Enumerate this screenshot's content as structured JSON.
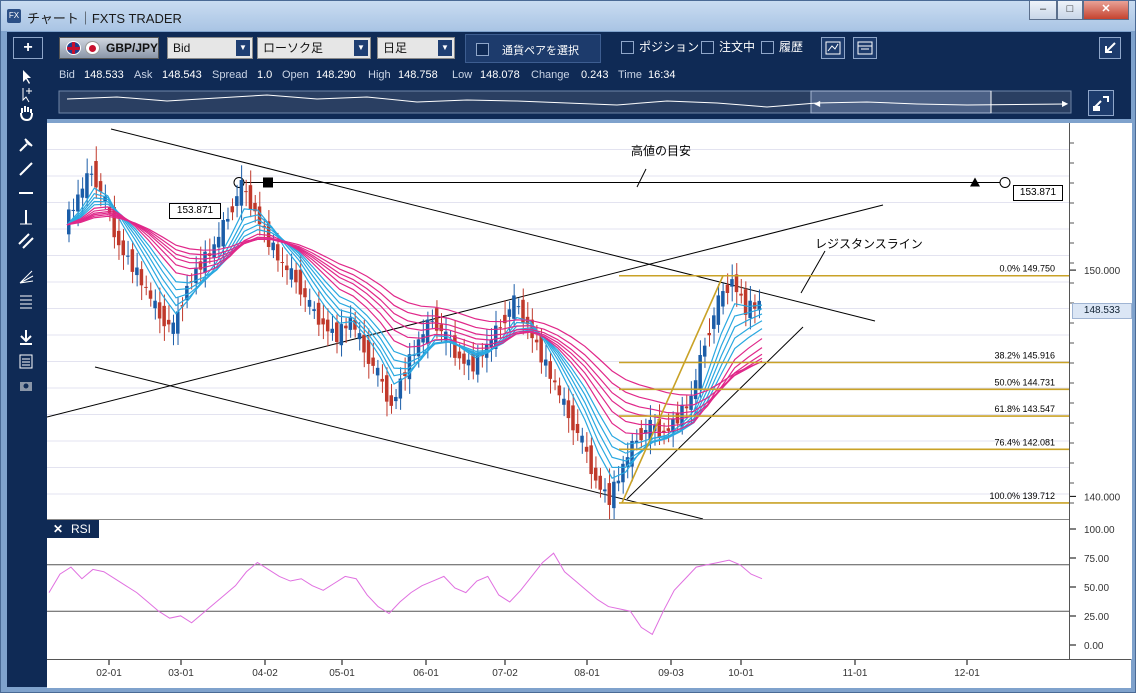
{
  "window": {
    "title": "チャート｜FXTS TRADER",
    "icon_label": "FX",
    "buttons": {
      "minimize": "–",
      "maximize": "□",
      "close": "✕"
    }
  },
  "toolbar": {
    "add_button": "+",
    "symbol": "GBP/JPY",
    "price_type": "Bid",
    "chart_type": "ローソク足",
    "timeframe": "日足",
    "currency_pair_select": "通貨ペアを選択",
    "position": "ポジション",
    "orders": "注文中",
    "history": "履歴"
  },
  "quote": {
    "bid_label": "Bid",
    "bid": "148.533",
    "ask_label": "Ask",
    "ask": "148.543",
    "spread_label": "Spread",
    "spread": "1.0",
    "open_label": "Open",
    "open": "148.290",
    "high_label": "High",
    "high": "148.758",
    "low_label": "Low",
    "low": "148.078",
    "change_label": "Change",
    "change": "0.243",
    "time_label": "Time",
    "time": "16:34"
  },
  "annotations": {
    "high_target": "高値の目安",
    "resistance": "レジスタンスライン",
    "level_left": "153.871",
    "level_right": "153.871",
    "current_price": "148.533"
  },
  "rsi_panel": {
    "label": "RSI"
  },
  "colors": {
    "panel_bg": "#0f2a55",
    "candle_up": "#1b5da8",
    "candle_down": "#c0392b",
    "fib": "#c9a227",
    "ema_fast": "#29a8e0",
    "ema_slow": "#e0288a",
    "rsi": "#e070e0"
  },
  "chart_data": [
    {
      "type": "candlestick",
      "title": "",
      "x_ticks": [
        "02-01",
        "03-01",
        "04-02",
        "05-01",
        "06-01",
        "07-02",
        "08-01",
        "09-03",
        "10-01",
        "11-01",
        "12-01"
      ],
      "y_ticks": [
        140.0,
        150.0
      ],
      "ylim": [
        139.0,
        156.5
      ],
      "closes": [
        152.0,
        153.2,
        154.4,
        153.0,
        151.1,
        150.2,
        149.1,
        148.0,
        147.4,
        149.3,
        150.3,
        151.0,
        152.4,
        153.7,
        152.6,
        151.3,
        150.2,
        149.6,
        148.4,
        147.6,
        147.1,
        147.8,
        146.5,
        145.4,
        144.0,
        145.6,
        146.8,
        147.9,
        147.0,
        146.1,
        145.8,
        146.6,
        147.6,
        148.6,
        147.6,
        146.2,
        144.9,
        143.6,
        142.4,
        140.7,
        139.9,
        141.3,
        142.6,
        143.1,
        142.8,
        143.5,
        144.3,
        146.8,
        148.6,
        149.6,
        148.3,
        148.5
      ],
      "fibonacci": [
        {
          "label": "0.0%",
          "value": 149.75
        },
        {
          "label": "38.2%",
          "value": 145.916
        },
        {
          "label": "50.0%",
          "value": 144.731
        },
        {
          "label": "61.8%",
          "value": 143.547
        },
        {
          "label": "76.4%",
          "value": 142.081
        },
        {
          "label": "100.0%",
          "value": 139.712
        }
      ],
      "horizontal_line": 153.871,
      "current_price": 148.533
    },
    {
      "type": "line",
      "title": "RSI",
      "y_ticks": [
        0.0,
        25.0,
        50.0,
        75.0,
        100.0
      ],
      "levels": [
        70,
        30
      ],
      "ylim": [
        0,
        100
      ],
      "values": [
        46,
        62,
        68,
        58,
        66,
        64,
        58,
        52,
        46,
        38,
        30,
        24,
        26,
        20,
        28,
        36,
        44,
        52,
        64,
        72,
        66,
        60,
        56,
        58,
        52,
        48,
        54,
        60,
        58,
        44,
        34,
        28,
        38,
        46,
        52,
        56,
        60,
        50,
        46,
        56,
        60,
        44,
        38,
        48,
        60,
        72,
        80,
        64,
        56,
        48,
        40,
        34,
        32,
        30,
        16,
        10,
        30,
        48,
        58,
        68,
        70,
        72,
        74,
        70,
        62,
        58
      ]
    }
  ]
}
